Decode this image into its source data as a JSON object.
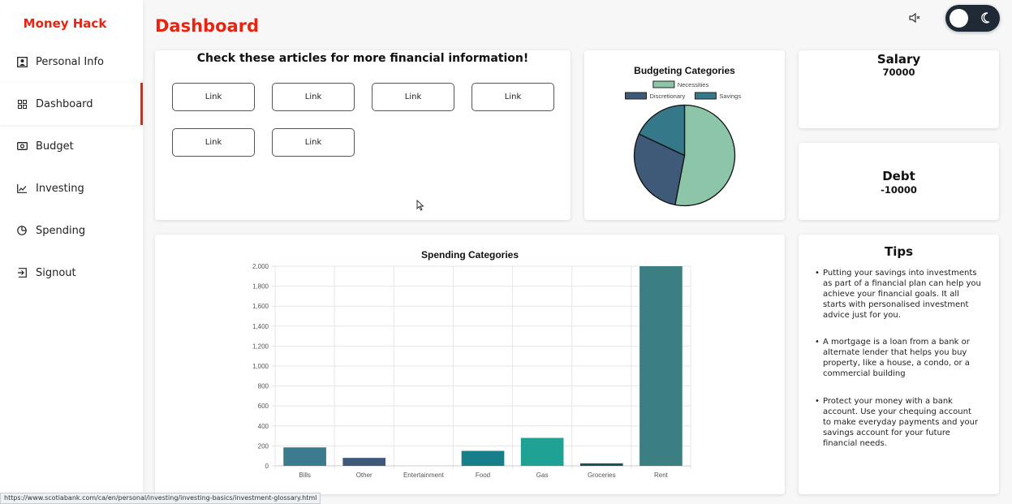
{
  "app": {
    "brand": "Money Hack",
    "page_title": "Dashboard"
  },
  "sidebar": {
    "items": [
      {
        "label": "Personal Info",
        "icon": "person-card-icon"
      },
      {
        "label": "Dashboard",
        "icon": "grid-icon",
        "active": true
      },
      {
        "label": "Budget",
        "icon": "money-icon"
      },
      {
        "label": "Investing",
        "icon": "line-chart-icon"
      },
      {
        "label": "Spending",
        "icon": "pie-chart-icon"
      },
      {
        "label": "Signout",
        "icon": "signout-icon"
      }
    ]
  },
  "header": {
    "sound_icon": "speaker-icon",
    "theme_toggle_icon": "moon-icon",
    "theme_toggle_on": false
  },
  "articles": {
    "title": "Check these articles for more financial information!",
    "links": [
      "Link",
      "Link",
      "Link",
      "Link",
      "Link",
      "Link"
    ]
  },
  "salary": {
    "label": "Salary",
    "value": "70000"
  },
  "debt": {
    "label": "Debt",
    "value": "-10000"
  },
  "tips": {
    "title": "Tips",
    "items": [
      "Putting your savings into investments as part of a financial plan can help you achieve your financial goals. It all starts with personalised investment advice just for you.",
      "A mortgage is a loan from a bank or alternate lender that helps you buy property, like a house, a condo, or a commercial building",
      "Protect your money with a bank account. Use your chequing account to make everyday payments and your savings account for your future financial needs."
    ]
  },
  "status_url": "https://www.scotiabank.com/ca/en/personal/investing/investing-basics/investment-glossary.html",
  "chart_data": [
    {
      "type": "pie",
      "title": "Budgeting Categories",
      "legend_position": "top",
      "categories": [
        "Necessities",
        "Discretionary",
        "Savings"
      ],
      "values": [
        53,
        29,
        18
      ],
      "colors": [
        "#8cc5a8",
        "#3f5a78",
        "#35788a"
      ]
    },
    {
      "type": "bar",
      "title": "Spending Categories",
      "categories": [
        "Bills",
        "Other",
        "Entertainment",
        "Food",
        "Gas",
        "Groceries",
        "Rent"
      ],
      "values": [
        185,
        80,
        0,
        150,
        280,
        25,
        2000
      ],
      "colors": [
        "#3c7a8e",
        "#3f5a78",
        "#3c7a8e",
        "#167f8a",
        "#1fa294",
        "#1f4f5a",
        "#3c7f83"
      ],
      "ylim": [
        0,
        2000
      ],
      "yticks": [
        "0",
        "200",
        "400",
        "600",
        "800",
        "1,000",
        "1,200",
        "1,400",
        "1,600",
        "1,800",
        "2,000"
      ],
      "grid": true
    }
  ]
}
